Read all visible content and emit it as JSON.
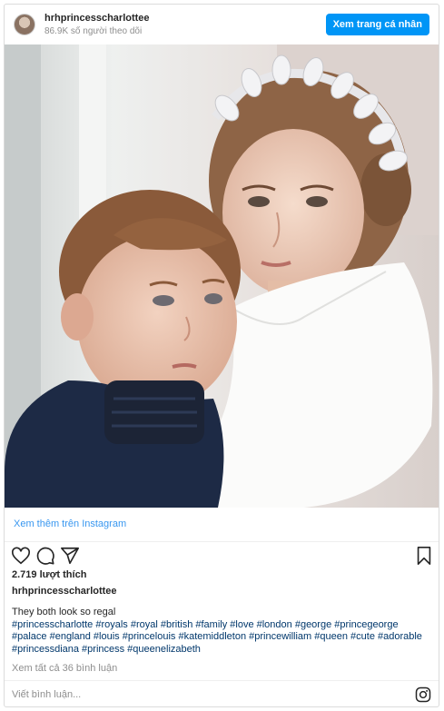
{
  "header": {
    "username": "hrhprincesscharlottee",
    "followers": "86.9K số người theo dõi",
    "profile_button": "Xem trang cá nhân"
  },
  "post": {
    "image_alt": "Prince Louis and Princess Charlotte"
  },
  "view_more": "Xem thêm trên Instagram",
  "actions": {
    "icons": [
      "heart-icon",
      "comment-icon",
      "share-icon",
      "bookmark-icon"
    ]
  },
  "likes": "2.719 lượt thích",
  "owner": "hrhprincesscharlottee",
  "caption": {
    "text": "They both look so regal",
    "hashtags": "#princesscharlotte #royals #royal #british #family #love #london #george #princegeorge #palace #england #louis #princelouis #katemiddleton #princewilliam #queen #cute #adorable #princessdiana #princess #queenelizabeth"
  },
  "comments_link": "Xem tất cả 36 bình luận",
  "comment_box": {
    "placeholder": "Viết bình luận..."
  },
  "colors": {
    "accent": "#0095f6",
    "link": "#3897f0",
    "hashtag": "#00376b",
    "muted": "#8e8e8e"
  }
}
